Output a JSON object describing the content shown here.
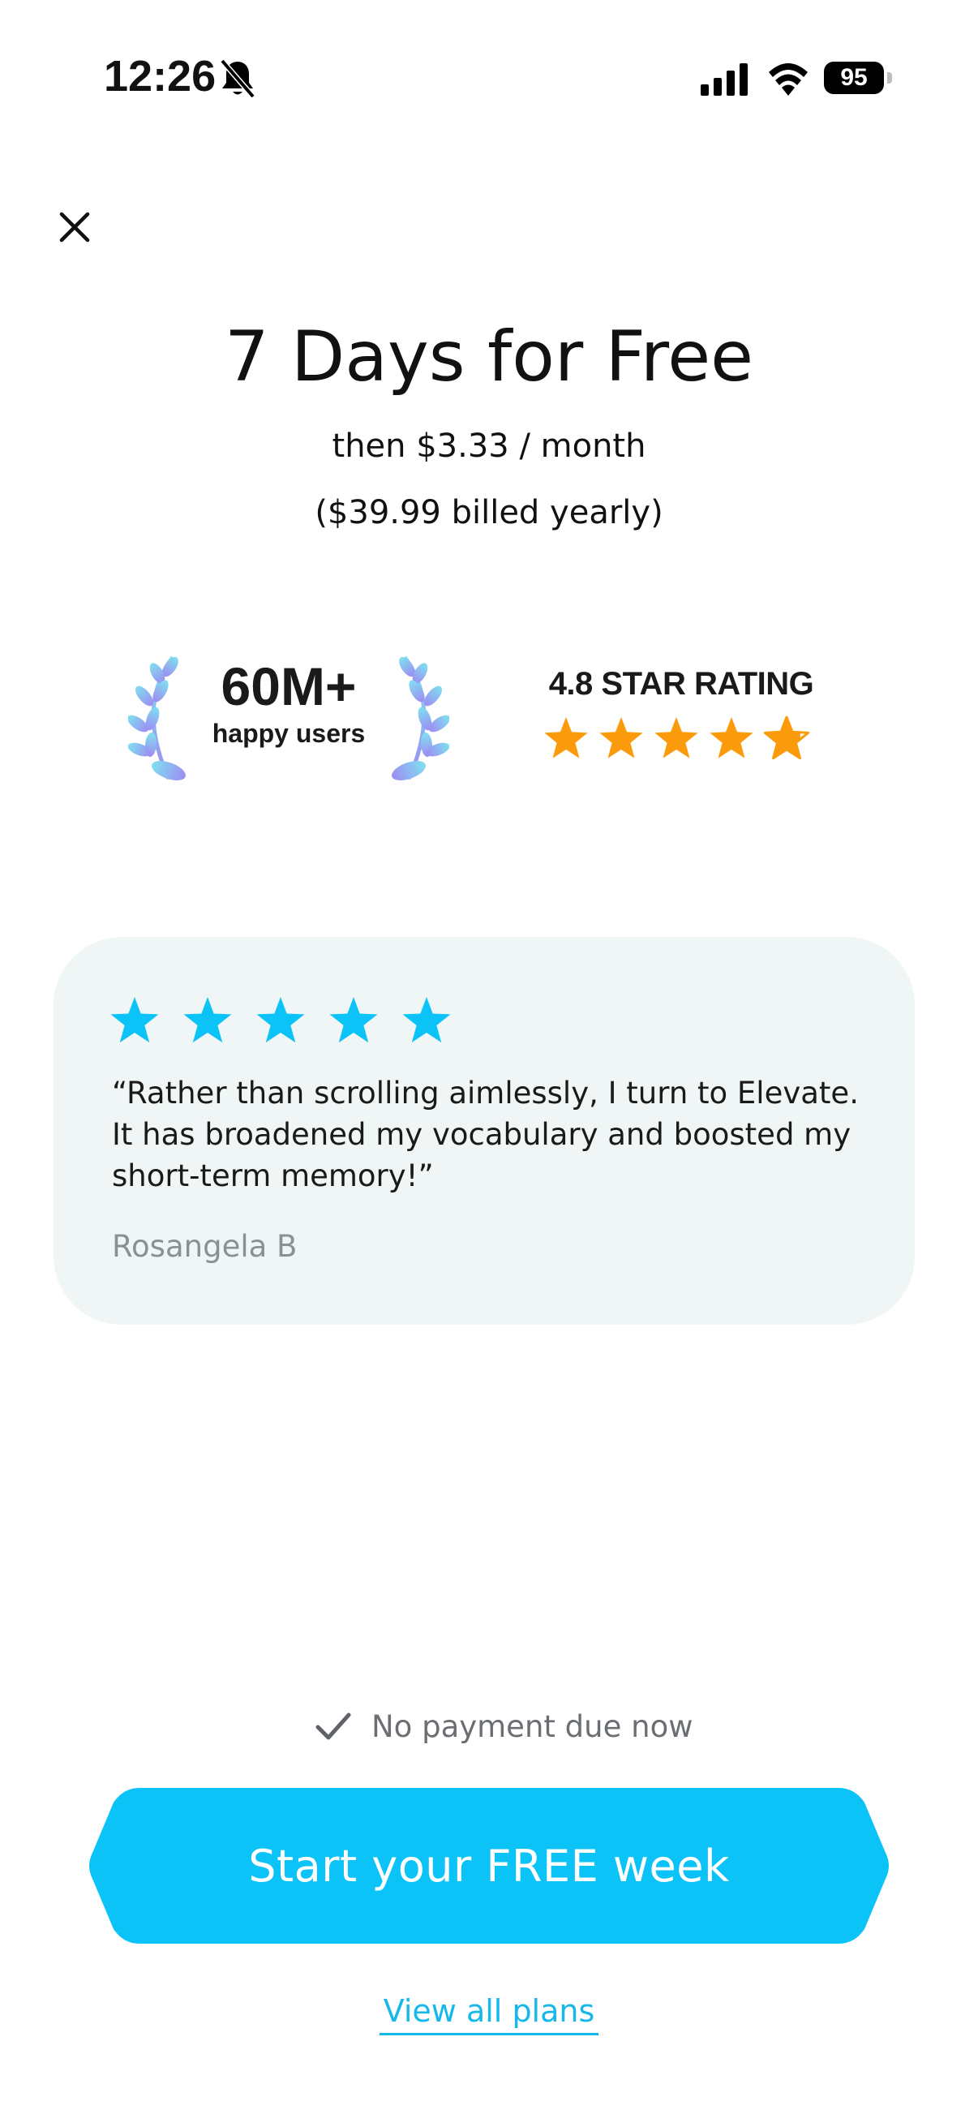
{
  "status_bar": {
    "time": "12:26",
    "battery": "95",
    "icons": [
      "bell-slash-icon",
      "cellular-signal-icon",
      "wifi-icon",
      "battery-icon"
    ]
  },
  "header": {
    "close_icon": "close-icon",
    "title": "7 Days for Free",
    "price_line": "then $3.33 / month",
    "billing_line": "($39.99 billed yearly)"
  },
  "badges": {
    "users_count": "60M+",
    "users_label": "happy users",
    "rating_label": "4.8 STAR RATING",
    "rating_value": 4.8,
    "rating_max": 5,
    "laurel_icon": "laurel-wreath-icon"
  },
  "review": {
    "stars": 5,
    "text": "“Rather than scrolling aimlessly, I turn to Elevate. It has broadened my vocabulary and boosted my short-term memory!”",
    "author": "Rosangela B"
  },
  "footer": {
    "check_icon": "checkmark-icon",
    "no_payment": "No payment due now",
    "cta_label": "Start your FREE week",
    "view_plans": "View all plans"
  },
  "colors": {
    "accent": "#0bc3f7",
    "link": "#16b8ea",
    "rating_star": "#fb9b0b",
    "card_bg": "#f0f6f5",
    "muted_text": "#8a9096"
  }
}
